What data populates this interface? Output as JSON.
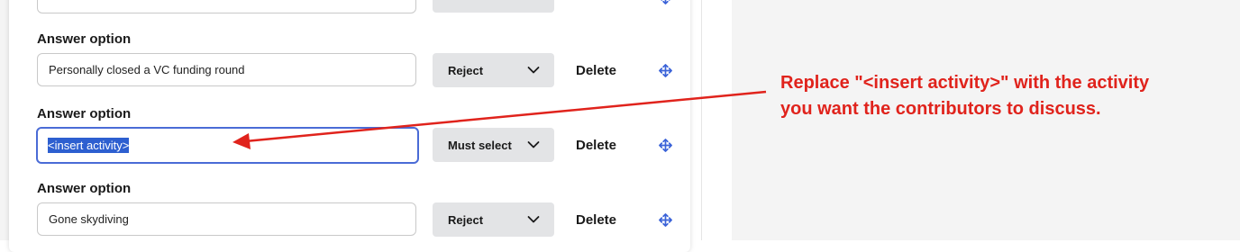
{
  "colors": {
    "accent_focus": "#4a6bd6",
    "selection": "#2d5fd0",
    "annotation": "#e0231c",
    "move_icon": "#3b63d8"
  },
  "options": [
    {
      "label": "Answer option",
      "value": "Personally closed a VC funding round",
      "rule": "Reject",
      "delete_label": "Delete"
    },
    {
      "label": "Answer option",
      "value": "<insert activity>",
      "rule": "Must select",
      "delete_label": "Delete",
      "focused": true,
      "selected": true
    },
    {
      "label": "Answer option",
      "value": "Gone skydiving",
      "rule": "Reject",
      "delete_label": "Delete"
    }
  ],
  "icons": {
    "dropdown": "chevron-down-icon",
    "move": "move-arrows-icon"
  },
  "annotation": {
    "line1": "Replace \"<insert activity>\" with the activity",
    "line2": "you want the contributors to discuss."
  }
}
